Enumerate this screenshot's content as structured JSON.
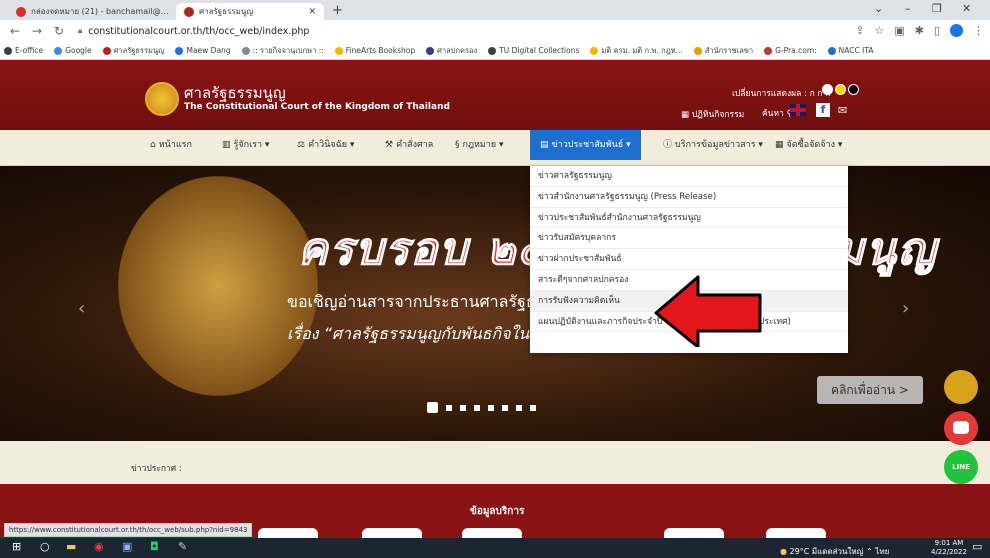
{
  "browser": {
    "tabs": [
      {
        "title": "กล่องจดหมาย (21) - banchamail@…",
        "favicon_color": "#d93025"
      },
      {
        "title": "ศาลรัฐธรรมนูญ",
        "favicon_color": "#b3261e"
      }
    ],
    "url": "constitutionalcourt.or.th/th/occ_web/index.php",
    "bookmarks": [
      {
        "label": "E-office",
        "color": "#3c4043"
      },
      {
        "label": "Google",
        "color": "#4285f4"
      },
      {
        "label": "ศาลรัฐธรรมนูญ",
        "color": "#b3261e"
      },
      {
        "label": "Maew Dang",
        "color": "#1a73e8"
      },
      {
        "label": ":: รายกิจจานุเบกษา ::",
        "color": "#7a8a99"
      },
      {
        "label": "FineArts Bookshop",
        "color": "#f2b705"
      },
      {
        "label": "ศาลปกครอง",
        "color": "#3a3a8c"
      },
      {
        "label": "TU Digital Collections",
        "color": "#3c4043"
      },
      {
        "label": "มติ ครม. มติ ก.พ. กฎห...",
        "color": "#f2b705"
      },
      {
        "label": "สำนักราชเลขา",
        "color": "#e6a100"
      },
      {
        "label": "G-Pra.com:",
        "color": "#c0392b"
      },
      {
        "label": "NACC ITA",
        "color": "#1f6fd1"
      }
    ],
    "status_url": "https://www.constitutionalcourt.or.th/th/occ_web/sub.php?nid=9843"
  },
  "site": {
    "name_th": "ศาลรัฐธรรมนูญ",
    "name_en": "The Constitutional Court of the Kingdom of Thailand",
    "font_size_label": "เปลี่ยนการแสดงผล : ก ก ก",
    "calendar_label": "ปฏิทินกิจกรรม",
    "search_label": "ค้นหา",
    "nav": [
      {
        "label": "หน้าแรก",
        "icon": "home-icon",
        "glyph": "⌂"
      },
      {
        "label": "รู้จักเรา ▾",
        "icon": "building-icon",
        "glyph": "▥"
      },
      {
        "label": "คำวินิจฉัย ▾",
        "icon": "scales-icon",
        "glyph": "⚖"
      },
      {
        "label": "คำสั่งศาล",
        "icon": "gavel-icon",
        "glyph": "⚒"
      },
      {
        "label": "กฎหมาย ▾",
        "icon": "law-book-icon",
        "glyph": "§"
      },
      {
        "label": "ข่าวประชาสัมพันธ์ ▾",
        "icon": "news-icon",
        "glyph": "▤"
      },
      {
        "label": "บริการข้อมูลข่าวสาร ▾",
        "icon": "info-service-icon",
        "glyph": "ⓘ"
      },
      {
        "label": "จัดซื้อจัดจ้าง ▾",
        "icon": "procurement-icon",
        "glyph": "▦"
      }
    ],
    "dropdown": [
      "ข่าวศาลรัฐธรรมนูญ",
      "ข่าวสำนักงานศาลรัฐธรรมนูญ (Press Release)",
      "ข่าวประชาสัมพันธ์สำนักงานศาลรัฐธรรมนูญ",
      "ข่าวรับสมัครบุคลากร",
      "ข่าวฝากประชาสัมพันธ์",
      "สาระดีๆจากศาลปกครอง",
      "การรับฟังความคิดเห็น",
      "แผนปฏิบัติงานและภารกิจประจำปี พ.ศ. ๒๕๖๕ (งานการต่างประเทศ)"
    ],
    "hero": {
      "title": "ครบรอบ ๒๔ ปี ศาลรัฐธรรมนูญ",
      "line1": "ขอเชิญอ่านสารจากประธานศาลรัฐธรรมนูญ เนื่องในโอกาสวันสัมพันธ์",
      "line2": "เรื่อง “ศาลรัฐธรรมนูญกับพันธกิจในการพิทักษ์รัฐธรรมนูญ”",
      "read_more": "คลิกเพื่ออ่าน >",
      "slides_total": 8,
      "slide_active": 1
    },
    "announcement_label": "ข่าวประกาศ :",
    "footer_title": "ข้อมูลบริการ"
  },
  "taskbar": {
    "weather": "29°C มีแดดส่วนใหญ่",
    "lang": "ไทย",
    "time": "9:01 AM",
    "date": "4/22/2022"
  }
}
